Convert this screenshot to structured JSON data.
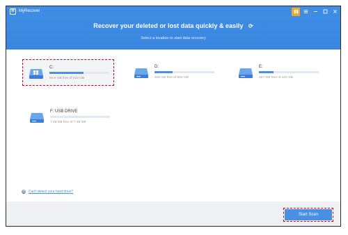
{
  "app": {
    "title": "MyRecover",
    "logo_letter": "R"
  },
  "header": {
    "headline": "Recover your deleted or lost data quickly & easily",
    "subline": "Select a location to start data recovery"
  },
  "window_controls": {
    "gift_icon": "gift-icon",
    "menu_icon": "menu-icon",
    "minimize_icon": "minimize-icon",
    "maximize_icon": "maximize-icon",
    "close_icon": "close-icon"
  },
  "drives": [
    {
      "name": "C:",
      "size_text": "94.6 GB free of 222 GB",
      "used_fraction": 0.57,
      "selected": true
    },
    {
      "name": "D:",
      "size_text": "349 GB free of 500 GB",
      "used_fraction": 0.3,
      "selected": false
    },
    {
      "name": "E:",
      "size_text": "327 GB free of 431 GB",
      "used_fraction": 0.24,
      "selected": false
    },
    {
      "name": "F: USB DRIVE",
      "size_text": "7.48 GB free of 7.48 GB",
      "used_fraction": 0.0,
      "selected": false
    }
  ],
  "help": {
    "label": "Can't detect your hard drive?"
  },
  "footer": {
    "start_scan_label": "Start Scan"
  },
  "colors": {
    "accent": "#4a90e2",
    "header": "#3b87e0",
    "selection": "#d0021b",
    "gift": "#f5a623"
  }
}
